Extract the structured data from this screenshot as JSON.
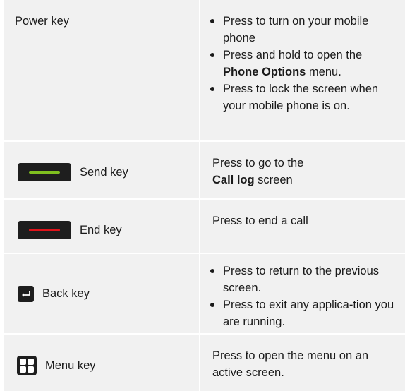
{
  "rows": [
    {
      "key": "Power key",
      "bullets": [
        {
          "text": "Press to turn on your mobile phone"
        },
        {
          "pre": "Press and hold to open the ",
          "bold": "Phone Options",
          "post": " menu."
        },
        {
          "text": "Press to lock the screen when your mobile phone is on."
        }
      ]
    },
    {
      "key": "Send key",
      "icon": "send-key-icon",
      "stripe_color": "#7fbf1f",
      "desc_pre": "Press to go to the",
      "desc_bold": "Call log",
      "desc_post": " screen"
    },
    {
      "key": "End key",
      "icon": "end-key-icon",
      "stripe_color": "#e0141b",
      "desc": "Press to end a call"
    },
    {
      "key": "Back key",
      "icon": "back-arrow-icon",
      "bullets": [
        {
          "text": "Press to return to the previous screen."
        },
        {
          "text": "Press to exit any applica-tion you are running."
        }
      ]
    },
    {
      "key": "Menu key",
      "icon": "menu-grid-icon",
      "desc": "Press to open the menu on an active screen."
    }
  ]
}
